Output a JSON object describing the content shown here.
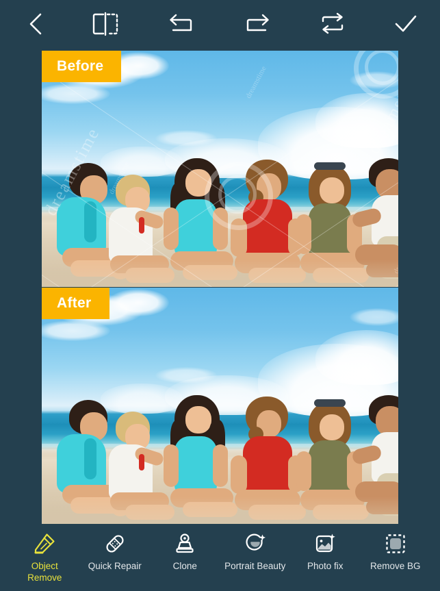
{
  "app": {
    "background_color": "#24404f",
    "accent_color": "#fbb400",
    "active_tool_color": "#e8e23c"
  },
  "topbar": {
    "buttons": [
      {
        "name": "back-button",
        "icon": "chevron-left-icon",
        "label": "Back"
      },
      {
        "name": "compare-button",
        "icon": "compare-split-icon",
        "label": "Compare"
      },
      {
        "name": "undo-button",
        "icon": "undo-arrow-icon",
        "label": "Undo"
      },
      {
        "name": "redo-button",
        "icon": "redo-arrow-icon",
        "label": "Redo"
      },
      {
        "name": "reset-button",
        "icon": "repeat-loop-icon",
        "label": "Reset"
      },
      {
        "name": "apply-button",
        "icon": "checkmark-icon",
        "label": "Apply"
      }
    ]
  },
  "preview": {
    "before": {
      "badge_label": "Before",
      "description": "Group of six young friends sitting on a sandy beach by a turquoise sea under a blue sky with white clouds",
      "watermark_text": "dreamstime",
      "watermark_visible": true
    },
    "after": {
      "badge_label": "After",
      "description": "Same beach group photo with the watermark removed",
      "watermark_text": "",
      "watermark_visible": false
    }
  },
  "bottombar": {
    "tools": [
      {
        "id": "object-remove",
        "label": "Object\nRemove",
        "icon": "eraser-marker-icon",
        "active": true
      },
      {
        "id": "quick-repair",
        "label": "Quick Repair",
        "icon": "bandage-icon",
        "active": false
      },
      {
        "id": "clone",
        "label": "Clone",
        "icon": "stamp-icon",
        "active": false
      },
      {
        "id": "portrait-beauty",
        "label": "Portrait Beauty",
        "icon": "face-sparkle-icon",
        "active": false
      },
      {
        "id": "photo-fix",
        "label": "Photo fix",
        "icon": "image-sparkle-icon",
        "active": false
      },
      {
        "id": "remove-bg",
        "label": "Remove BG",
        "icon": "dashed-square-icon",
        "active": false
      }
    ]
  }
}
